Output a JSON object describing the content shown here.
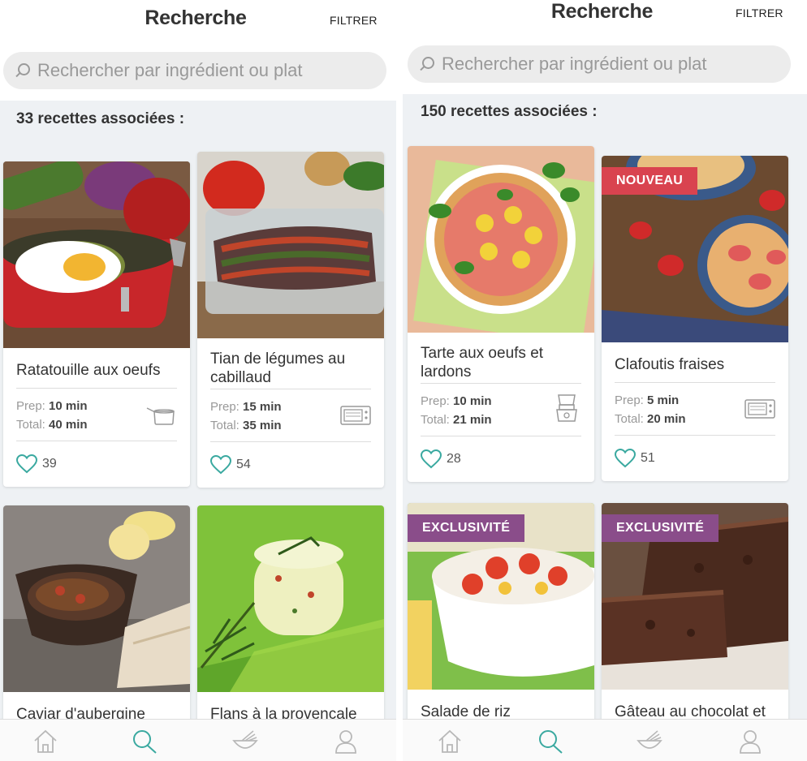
{
  "screens": [
    {
      "header": {
        "title": "Recherche",
        "filter": "FILTRER"
      },
      "search": {
        "placeholder": "Rechercher par ingrédient ou plat"
      },
      "result_count": "33 recettes associées :",
      "cards": [
        {
          "title": "Ratatouille aux oeufs",
          "prep_label": "Prep:",
          "prep": "10 min",
          "total_label": "Total:",
          "total": "40 min",
          "likes": "39",
          "device": "saucepan-icon"
        },
        {
          "title": "Tian de légumes au cabillaud",
          "prep_label": "Prep:",
          "prep": "15 min",
          "total_label": "Total:",
          "total": "35 min",
          "likes": "54",
          "device": "oven-icon"
        },
        {
          "title": "Caviar d'aubergine"
        },
        {
          "title": "Flans à la provençale"
        }
      ]
    },
    {
      "header": {
        "title": "Recherche",
        "filter": "FILTRER"
      },
      "search": {
        "placeholder": "Rechercher par ingrédient ou plat"
      },
      "result_count": "150 recettes associées :",
      "cards": [
        {
          "title": "Tarte aux oeufs et lardons",
          "prep_label": "Prep:",
          "prep": "10 min",
          "total_label": "Total:",
          "total": "21 min",
          "likes": "28",
          "device": "mixer-icon"
        },
        {
          "title": "Clafoutis fraises",
          "badge": "NOUVEAU",
          "prep_label": "Prep:",
          "prep": "5 min",
          "total_label": "Total:",
          "total": "20 min",
          "likes": "51",
          "device": "oven-icon"
        },
        {
          "title": "Salade de riz",
          "badge": "EXCLUSIVITÉ"
        },
        {
          "title": "Gâteau au chocolat et",
          "badge": "EXCLUSIVITÉ"
        }
      ]
    }
  ],
  "tabbar": {
    "items": [
      "home-icon",
      "search-icon",
      "whisk-icon",
      "profile-icon"
    ],
    "active": "search-icon",
    "active_color": "#3aa9a0",
    "inactive_color": "#b8b8b8"
  },
  "colors": {
    "heart": "#3aa9a0",
    "badge_new": "#d9434f",
    "badge_exclusive": "#8a4d8a"
  }
}
